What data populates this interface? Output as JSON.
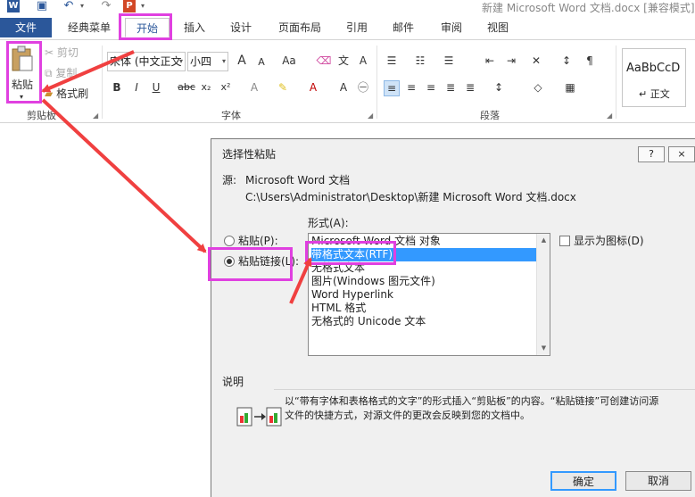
{
  "window": {
    "title": "新建 Microsoft Word 文档.docx [兼容模式]"
  },
  "tabs": [
    "文件",
    "经典菜单",
    "开始",
    "插入",
    "设计",
    "页面布局",
    "引用",
    "邮件",
    "审阅",
    "视图"
  ],
  "clipboard": {
    "paste_label": "粘贴",
    "cut_label": "剪切",
    "copy_label": "复制",
    "format_painter_label": "格式刷",
    "group_label": "剪贴板"
  },
  "font": {
    "font_name": "宋体 (中文正文",
    "font_size": "小四",
    "group_label": "字体",
    "bold": "B",
    "italic": "I",
    "underline": "U",
    "strike": "abc",
    "subscript": "x₂",
    "superscript": "x²",
    "case": "Aa",
    "grow": "A",
    "shrink": "A"
  },
  "paragraph": {
    "group_label": "段落"
  },
  "styles": {
    "preview": "AaBbCcD",
    "name": "↵ 正文"
  },
  "dialog": {
    "title": "选择性粘贴",
    "help_label": "?",
    "close_label": "×",
    "source_label": "源:",
    "source_name": "Microsoft Word 文档",
    "source_path": "C:\\Users\\Administrator\\Desktop\\新建 Microsoft Word 文档.docx",
    "format_label": "形式(A):",
    "paste_radio": "粘贴(P):",
    "paste_link_radio": "粘贴链接(L):",
    "display_as_icon": "显示为图标(D)",
    "formats": [
      "Microsoft Word 文档 对象",
      "带格式文本(RTF)",
      "无格式文本",
      "图片(Windows 图元文件)",
      "Word Hyperlink",
      "HTML 格式",
      "无格式的 Unicode 文本"
    ],
    "selected_index": 1,
    "description_label": "说明",
    "description_line1": "以“带有字体和表格格式的文字”的形式插入“剪贴板”的内容。“粘贴链接”可创建访问源",
    "description_line2": "文件的快捷方式，对源文件的更改会反映到您的文档中。",
    "ok_label": "确定",
    "cancel_label": "取消"
  },
  "colors": {
    "accent": "#2b579a",
    "highlight": "#e040e0",
    "arrow": "#f04040",
    "selection": "#3399ff"
  }
}
